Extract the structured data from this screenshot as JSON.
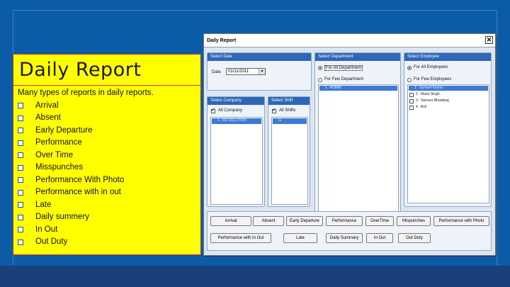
{
  "slide": {
    "title": "Daily Report",
    "intro": "Many types of reports in daily reports.",
    "items": [
      "Arrival",
      "Absent",
      "Early Departure",
      "Performance",
      "Over Time",
      "Misspunches",
      "Performance With Photo",
      "Performance with in out",
      "Late",
      "Daily summery",
      "In Out",
      "Out Duty"
    ]
  },
  "dialog": {
    "title": "Daily Report",
    "select_date": {
      "header": "Select Date",
      "date_label": "Date",
      "date_value": "01/11/2011"
    },
    "select_department": {
      "header": "Select Department",
      "opt_all": "For All Department",
      "opt_few": "For Few Department",
      "list_item": "1 : ADMIN"
    },
    "select_employee": {
      "header": "Select Employee",
      "opt_all": "For All Employees",
      "opt_few": "For Few Employees",
      "rows": [
        "1 : Sumeet Kumar",
        "2 : Manu Singh",
        "3 : Sarveer Bhardwaj",
        "4 : Anil"
      ]
    },
    "select_company": {
      "header": "Select Company",
      "all_label": "All Company",
      "list_item": "1 : RS SOLUTION"
    },
    "select_shift": {
      "header": "Select Shift",
      "all_label": "All Shifts",
      "list_item": "G"
    },
    "buttons_row1": [
      "Arrival",
      "Absent",
      "Early Departure",
      "Performance",
      "OverTime",
      "Mispunches",
      "Performance with Photo"
    ],
    "buttons_row2": [
      "Performance with In Out",
      "Late",
      "Daily Summary",
      "In Out",
      "Out Duty"
    ]
  },
  "colors": {
    "slide_bg": "#0b5ba6",
    "box_bg": "#ffff00",
    "group_header": "#2e66b8"
  }
}
